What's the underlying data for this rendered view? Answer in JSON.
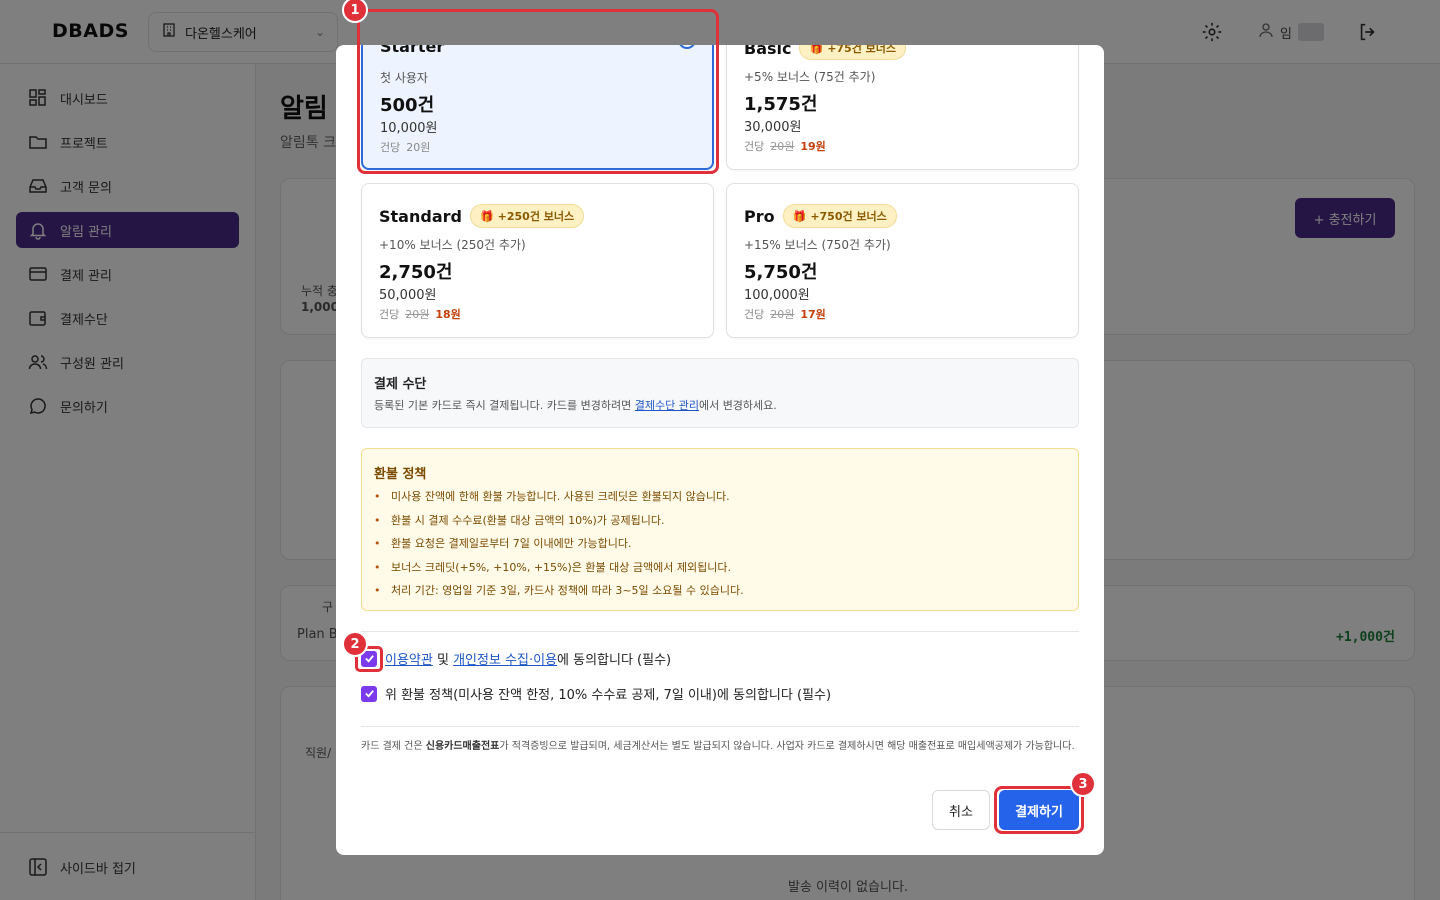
{
  "app": {
    "logo": "DBADS",
    "org_select": "다온헬스케어",
    "user_initial": "임"
  },
  "sidebar": {
    "items": [
      {
        "label": "대시보드",
        "icon": "dashboard-icon"
      },
      {
        "label": "프로젝트",
        "icon": "folder-icon"
      },
      {
        "label": "고객 문의",
        "icon": "inbox-icon"
      },
      {
        "label": "알림 관리",
        "icon": "bell-icon",
        "active": true
      },
      {
        "label": "결제 관리",
        "icon": "credit-card-icon"
      },
      {
        "label": "결제수단",
        "icon": "wallet-icon"
      },
      {
        "label": "구성원 관리",
        "icon": "users-icon"
      },
      {
        "label": "문의하기",
        "icon": "chat-icon"
      }
    ],
    "collapse_label": "사이드바 접기"
  },
  "background": {
    "page_title": "알림",
    "page_sub": "알림톡 크",
    "charge_button": "+ 충전하기",
    "stat_label": "누적 충",
    "stat_value": "1,000",
    "plan_row_label": "구",
    "plan_row_text": "Plan B",
    "plan_row_amount": "+1,000건",
    "staff_text": "직원/",
    "empty_history": "발송 이력이 없습니다."
  },
  "modal": {
    "plans": [
      {
        "name": "Starter",
        "bonus": "",
        "desc": "첫 사용자",
        "count": "500건",
        "price": "10,000원",
        "unit_label": "건당",
        "unit_old": "",
        "unit_new": "20원",
        "selected": true
      },
      {
        "name": "Basic",
        "bonus": "+75건 보너스",
        "desc": "+5% 보너스 (75건 추가)",
        "count": "1,575건",
        "price": "30,000원",
        "unit_label": "건당",
        "unit_old": "20원",
        "unit_new": "19원",
        "selected": false
      },
      {
        "name": "Standard",
        "bonus": "+250건 보너스",
        "desc": "+10% 보너스 (250건 추가)",
        "count": "2,750건",
        "price": "50,000원",
        "unit_label": "건당",
        "unit_old": "20원",
        "unit_new": "18원",
        "selected": false
      },
      {
        "name": "Pro",
        "bonus": "+750건 보너스",
        "desc": "+15% 보너스 (750건 추가)",
        "count": "5,750건",
        "price": "100,000원",
        "unit_label": "건당",
        "unit_old": "20원",
        "unit_new": "17원",
        "selected": false
      }
    ],
    "payment": {
      "title": "결제 수단",
      "desc_before": "등록된 기본 카드로 즉시 결제됩니다. 카드를 변경하려면 ",
      "desc_link": "결제수단 관리",
      "desc_after": "에서 변경하세요."
    },
    "refund": {
      "title": "환불 정책",
      "items": [
        "미사용 잔액에 한해 환불 가능합니다. 사용된 크레딧은 환불되지 않습니다.",
        "환불 시 결제 수수료(환불 대상 금액의 10%)가 공제됩니다.",
        "환불 요청은 결제일로부터 7일 이내에만 가능합니다.",
        "보너스 크레딧(+5%, +10%, +15%)은 환불 대상 금액에서 제외됩니다.",
        "처리 기간: 영업일 기준 3일, 카드사 정책에 따라 3~5일 소요될 수 있습니다."
      ]
    },
    "agree_terms": {
      "link1": "이용약관",
      "mid": " 및 ",
      "link2": "개인정보 수집·이용",
      "tail": "에 동의합니다 (필수)",
      "checked": true
    },
    "agree_refund": {
      "label": "위 환불 정책(미사용 잔액 한정, 10% 수수료 공제, 7일 이내)에 동의합니다 (필수)",
      "checked": true
    },
    "notice": {
      "before": "카드 결제 건은 ",
      "bold": "신용카드매출전표",
      "after": "가 적격증빙으로 발급되며, 세금계산서는 별도 발급되지 않습니다. 사업자 카드로 결제하시면 해당 매출전표로 매입세액공제가 가능합니다."
    },
    "cancel_button": "취소",
    "pay_button": "결제하기"
  },
  "annotations": [
    "1",
    "2",
    "3"
  ],
  "colors": {
    "accent_purple": "#4a2a8a",
    "primary_blue": "#2563eb",
    "checkbox_purple": "#7c3aed",
    "annotation_red": "#e0303a"
  }
}
